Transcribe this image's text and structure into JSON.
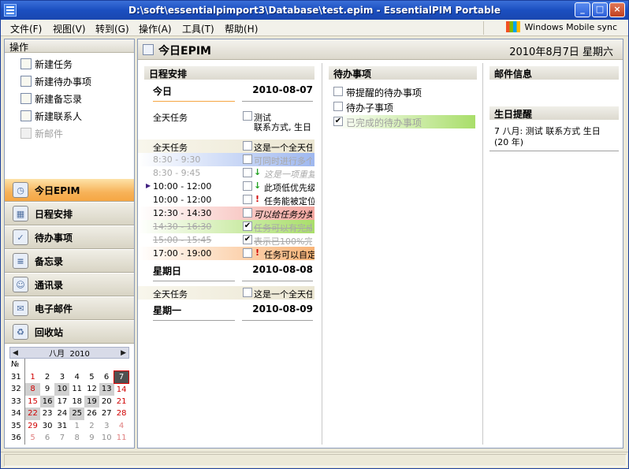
{
  "window": {
    "title": "D:\\soft\\essentialpimport3\\Database\\test.epim - EssentialPIM Portable",
    "min": "_",
    "max": "□",
    "close": "×"
  },
  "menu": [
    "文件(F)",
    "视图(V)",
    "转到(G)",
    "操作(A)",
    "工具(T)",
    "帮助(H)"
  ],
  "sync": {
    "label": "Windows Mobile sync"
  },
  "ops": {
    "header": "操作",
    "items": [
      "新建任务",
      "新建待办事项",
      "新建备忘录",
      "新建联系人",
      "新邮件"
    ]
  },
  "nav": [
    "今日EPIM",
    "日程安排",
    "待办事项",
    "备忘录",
    "通讯录",
    "电子邮件",
    "回收站"
  ],
  "calendar": {
    "month": "八月",
    "year": "2010",
    "wk_header": "№",
    "rows": [
      {
        "wk": "31",
        "days": [
          "1",
          "2",
          "3",
          "4",
          "5",
          "6",
          "7"
        ]
      },
      {
        "wk": "32",
        "days": [
          "8",
          "9",
          "10",
          "11",
          "12",
          "13",
          "14"
        ]
      },
      {
        "wk": "33",
        "days": [
          "15",
          "16",
          "17",
          "18",
          "19",
          "20",
          "21"
        ]
      },
      {
        "wk": "34",
        "days": [
          "22",
          "23",
          "24",
          "25",
          "26",
          "27",
          "28"
        ]
      },
      {
        "wk": "35",
        "days": [
          "29",
          "30",
          "31",
          "1",
          "2",
          "3",
          "4"
        ]
      },
      {
        "wk": "36",
        "days": [
          "5",
          "6",
          "7",
          "8",
          "9",
          "10",
          "11"
        ]
      }
    ]
  },
  "main": {
    "title": "今日EPIM",
    "date": "2010年8月7日 星期六"
  },
  "schedule": {
    "header": "日程安排",
    "day1": {
      "label": "今日",
      "date": "2010-08-07"
    },
    "allday1": {
      "label": "全天任务",
      "text": "测试",
      "text2": "联系方式, 生日"
    },
    "allday2": {
      "label": "全天任务",
      "text": "这是一个全天任务"
    },
    "rows": [
      {
        "time": "8:30 - 9:30",
        "text": "可同时进行多个任务"
      },
      {
        "time": "8:30 - 9:45",
        "text": "这是一项重复任务"
      },
      {
        "time": "10:00 - 12:00",
        "text": "此项低优先级"
      },
      {
        "time": "10:00 - 12:00",
        "text": "任务能被定位"
      },
      {
        "time": "12:30 - 14:30",
        "text": "可以给任务分类"
      },
      {
        "time": "14:30 - 16:30",
        "text": "任务可以有完成"
      },
      {
        "time": "15:00 - 15:45",
        "text": "表示已100%完成"
      },
      {
        "time": "17:00 - 19:00",
        "text": "任务可以自定"
      }
    ],
    "day2": {
      "label": "星期日",
      "date": "2010-08-08"
    },
    "allday3": {
      "label": "全天任务",
      "text": "这是一个全天任务"
    },
    "day3": {
      "label": "星期一",
      "date": "2010-08-09"
    }
  },
  "todos": {
    "header": "待办事项",
    "items": [
      "带提醒的待办事项",
      "待办子事项",
      "已完成的待办事项"
    ]
  },
  "mail": {
    "header": "邮件信息"
  },
  "birthday": {
    "header": "生日提醒",
    "entry": "7 八月: 测试 联系方式 生日 (20 年)"
  },
  "colors": {
    "accent": "#f5a643",
    "today_bg": "#505050",
    "green": "#a9de6a",
    "red": "#f4a7a0",
    "blue": "#9fb8ef",
    "orange": "#f9b477"
  }
}
